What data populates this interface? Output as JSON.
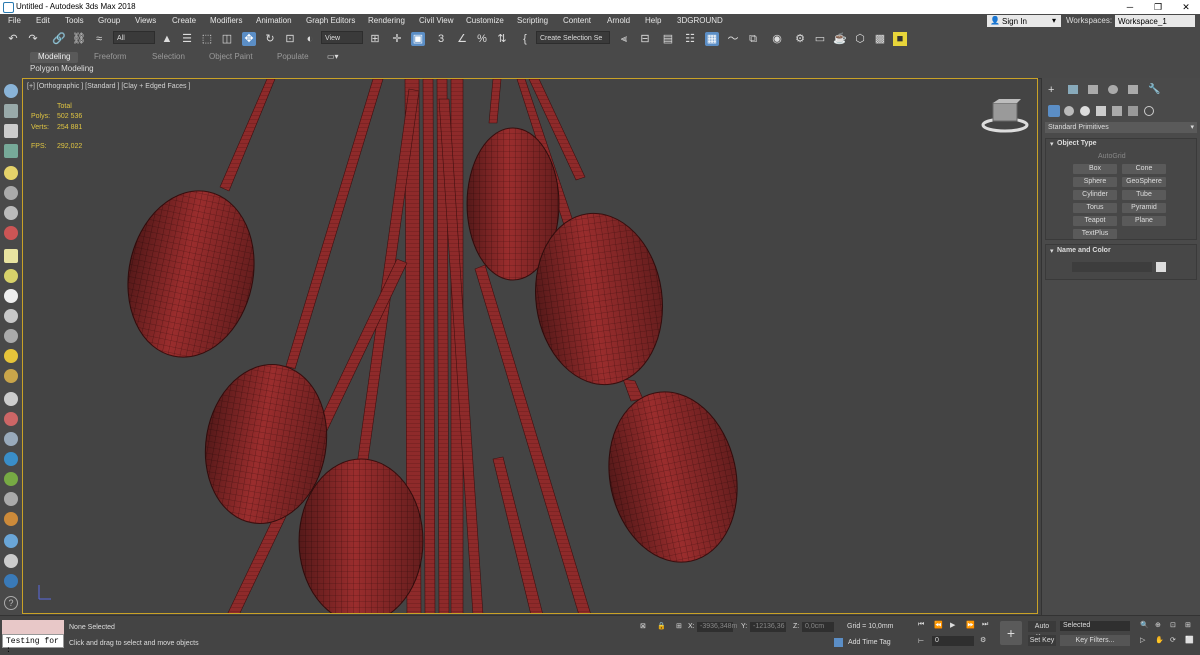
{
  "window": {
    "title": "Untitled - Autodesk 3ds Max 2018"
  },
  "menu": [
    "File",
    "Edit",
    "Tools",
    "Group",
    "Views",
    "Create",
    "Modifiers",
    "Animation",
    "Graph Editors",
    "Rendering",
    "Civil View",
    "Customize",
    "Scripting",
    "Content",
    "Arnold",
    "Help",
    "3DGROUND"
  ],
  "account": {
    "sign_in": "Sign In",
    "workspaces_label": "Workspaces:",
    "workspace": "Workspace_1"
  },
  "toolbar": {
    "filter": "All",
    "ref_coord": "View",
    "selection_set": "Create Selection Se"
  },
  "ribbon": {
    "tabs": [
      "Modeling",
      "Freeform",
      "Selection",
      "Object Paint",
      "Populate"
    ],
    "active": "Modeling",
    "subtitle": "Polygon Modeling"
  },
  "viewport": {
    "label": "[+] [Orthographic ] [Standard ] [Clay + Edged Faces ]",
    "stats": {
      "total": "Total",
      "polys_label": "Polys:",
      "polys": "502 536",
      "verts_label": "Verts:",
      "verts": "254 881",
      "fps_label": "FPS:",
      "fps": "292,022"
    },
    "colors": {
      "mesh": "#9a2d2d",
      "wire": "#4a1212",
      "bg": "#444444",
      "border": "#c9a227"
    }
  },
  "command_panel": {
    "dropdown": "Standard Primitives",
    "object_type_title": "Object Type",
    "autogrid": "AutoGrid",
    "buttons": [
      "Box",
      "Cone",
      "Sphere",
      "GeoSphere",
      "Cylinder",
      "Tube",
      "Torus",
      "Pyramid",
      "Teapot",
      "Plane",
      "TextPlus"
    ],
    "name_color_title": "Name and Color"
  },
  "status": {
    "script": "Testing for :",
    "selection": "None Selected",
    "hint": "Click and drag to select and move objects",
    "x_label": "X:",
    "x_value": "-3936,348m",
    "y_label": "Y:",
    "y_value": "-12136,36",
    "z_label": "Z:",
    "z_value": "0,0cm",
    "grid": "Grid = 10,0mm",
    "add_time_tag": "Add Time Tag",
    "frame": "0",
    "auto_key": "Auto Key",
    "set_key": "Set Key",
    "key_mode": "Selected",
    "key_filters": "Key Filters..."
  }
}
